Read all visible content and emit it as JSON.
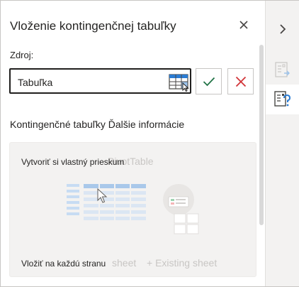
{
  "pane": {
    "title": "Vloženie kontingenčnej tabuľky",
    "source_label": "Zdroj:",
    "source_value": "Tabuľka",
    "info_text": "Kontingenčné tabuľky Ďalšie informácie",
    "card": {
      "primary_text": "Vytvoriť si vlastný prieskum",
      "ghost_title": "PivotTable",
      "footer_text": "Vložiť na každú stranu",
      "ghost_new_sheet": "sheet",
      "ghost_existing_sheet": "+ Existing sheet"
    }
  },
  "icons": {
    "close": "close-icon",
    "confirm": "check-icon",
    "cancel": "x-icon",
    "table_picker": "table-select-icon",
    "rail_expand": "chevron-right-icon",
    "rail_field_list": "pivot-fields-icon",
    "rail_help": "pivot-help-icon"
  },
  "colors": {
    "confirm": "#217346",
    "cancel": "#d13438",
    "accent_blue": "#2b7cd3"
  }
}
